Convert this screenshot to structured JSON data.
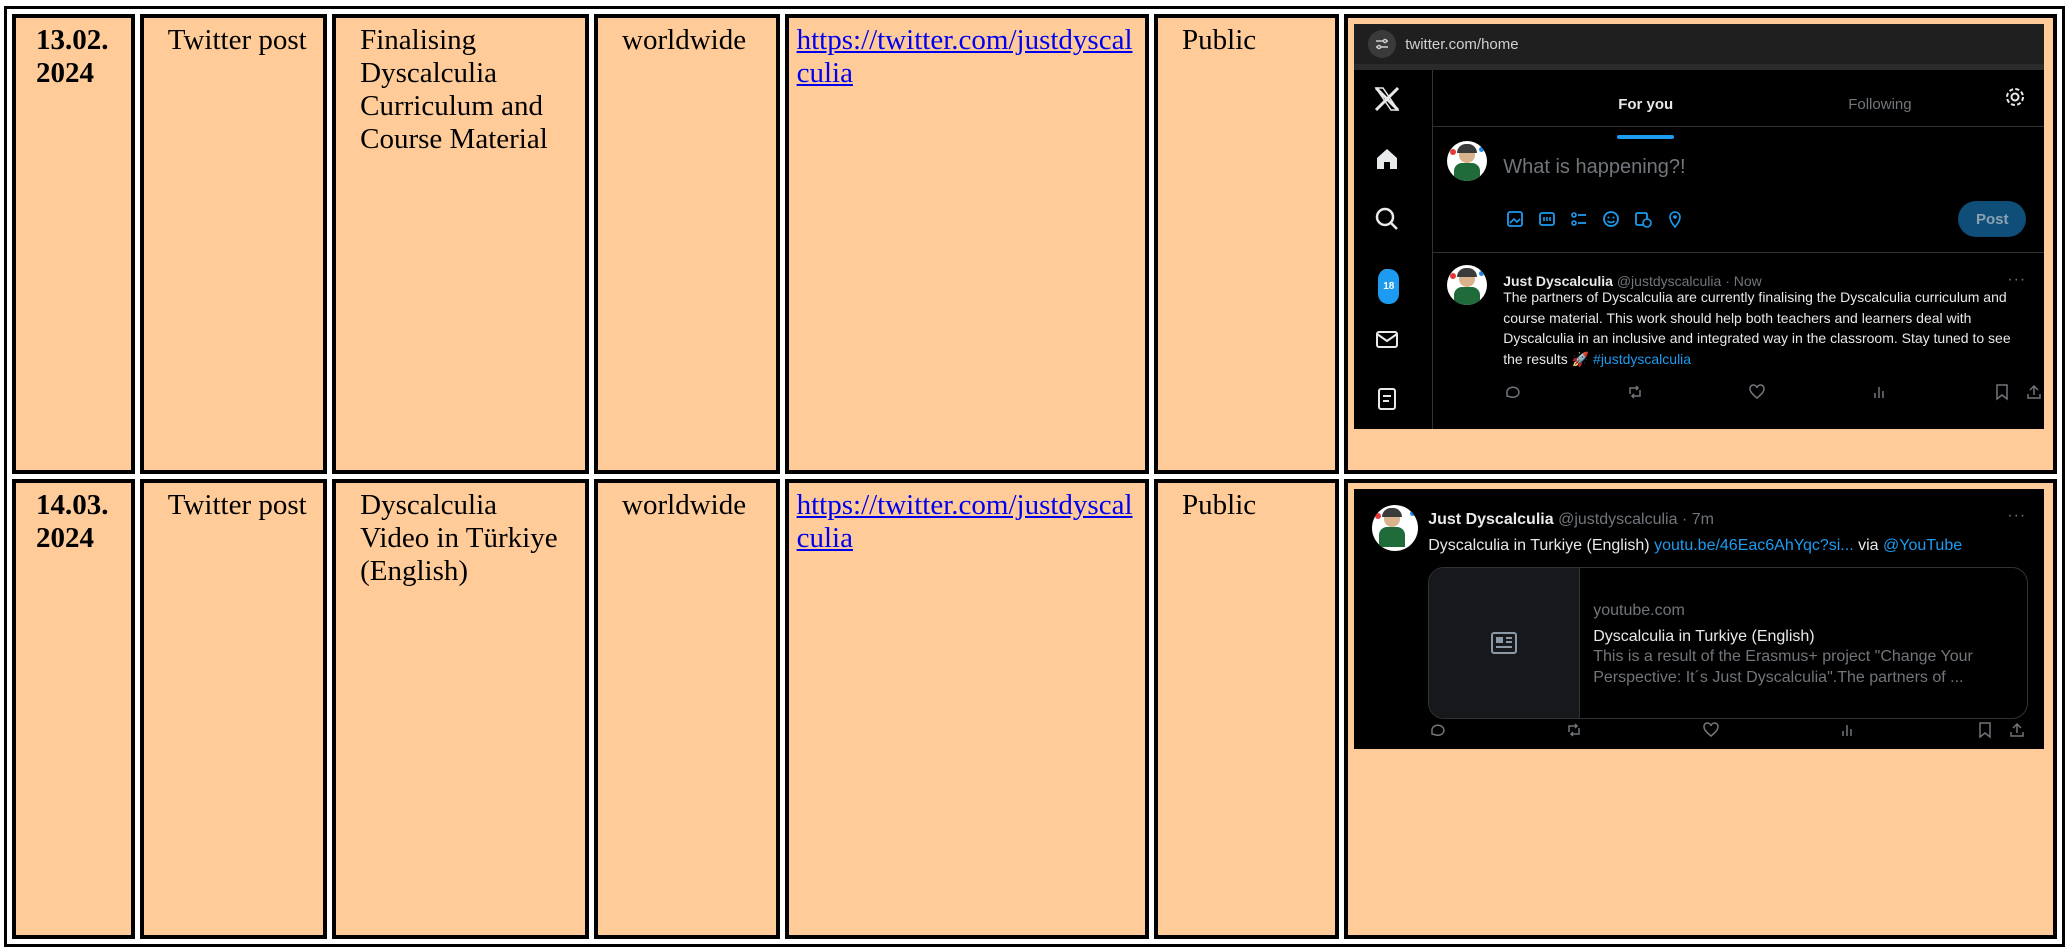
{
  "rows": [
    {
      "date": "13.02. 2024",
      "type": "Twitter post",
      "title": "Finalising Dyscalculia Curriculum and Course Material",
      "reach": "worldwide",
      "link": "https://twitter.com/justdyscalculia",
      "audience": "Public",
      "screenshot": {
        "url": "twitter.com/home",
        "tab_for_you": "For you",
        "tab_following": "Following",
        "compose_placeholder": "What is happening?!",
        "post_button": "Post",
        "notifications_badge": "18",
        "tweet_name": "Just Dyscalculia",
        "tweet_meta": "@justdyscalculia · Now",
        "tweet_text": "The partners of Dyscalculia are currently finalising the Dyscalculia curriculum and course material. This work should help both teachers and learners deal with Dyscalculia in an inclusive and integrated way in the classroom. Stay tuned to see the results 🚀",
        "tweet_hashtag": "#justdyscalculia"
      }
    },
    {
      "date": "14.03. 2024",
      "type": "Twitter post",
      "title": "Dyscalculia Video in Türkiye (English)",
      "reach": "worldwide",
      "link": "https://twitter.com/justdyscalculia",
      "audience": "Public",
      "screenshot": {
        "tweet_name": "Just Dyscalculia",
        "tweet_meta": "@justdyscalculia · 7m",
        "tweet_text": "Dyscalculia in Turkiye (English)",
        "tweet_link": "youtu.be/46Eac6AhYqc?si...",
        "tweet_via": "via",
        "tweet_mention": "@YouTube",
        "card_domain": "youtube.com",
        "card_title": "Dyscalculia in Turkiye (English)",
        "card_desc": "This is a result of the Erasmus+ project \"Change Your Perspective: It´s Just Dyscalculia\".The partners of ..."
      }
    }
  ],
  "colors": {
    "cell_bg": "#FFCC99",
    "link": "#0000EE",
    "twitter_blue": "#1d9bf0"
  }
}
